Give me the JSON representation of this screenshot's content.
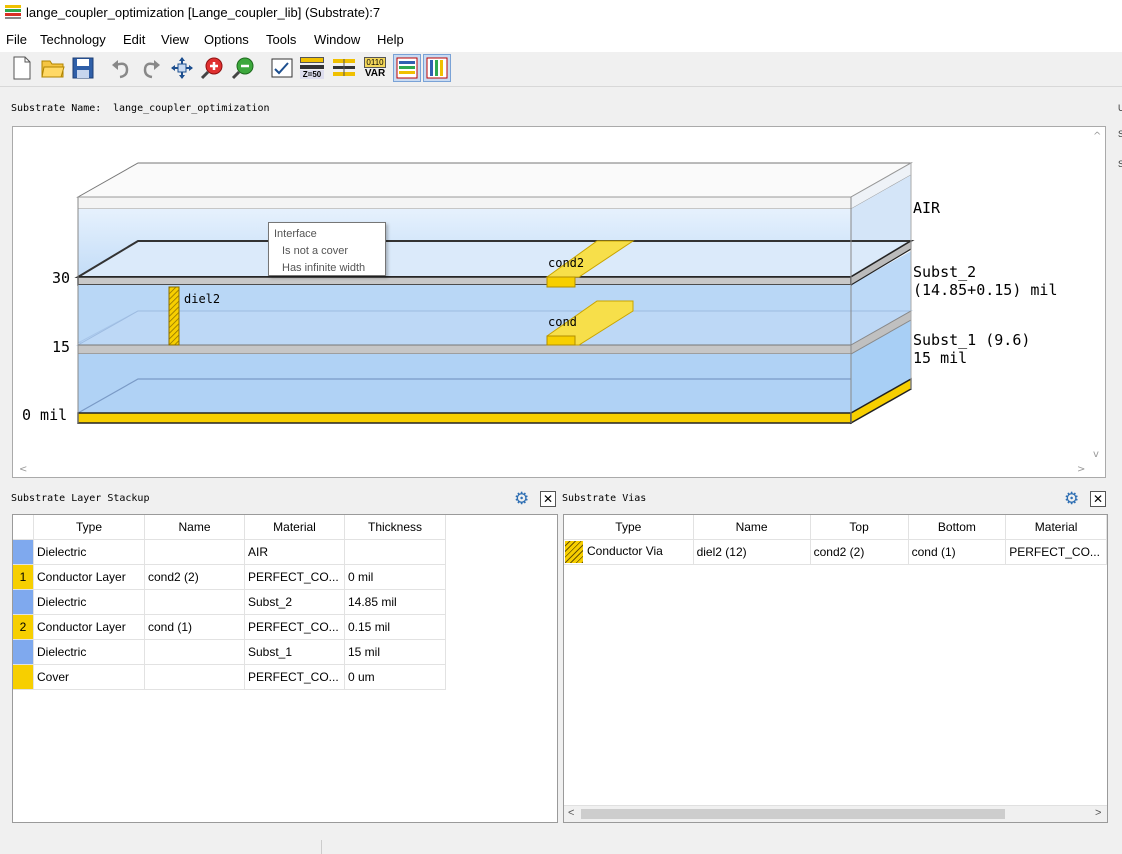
{
  "window": {
    "title": "lange_coupler_optimization [Lange_coupler_lib] (Substrate):7"
  },
  "menu": [
    "File",
    "Technology",
    "Edit",
    "View",
    "Options",
    "Tools",
    "Window",
    "Help"
  ],
  "toolbar": {
    "icons": [
      "new-file-icon",
      "open-folder-icon",
      "save-icon",
      "undo-icon",
      "redo-icon",
      "pan-icon",
      "zoom-in-icon",
      "zoom-out-icon",
      "check-icon",
      "z50-icon",
      "layer-align-icon",
      "var-icon",
      "horizontal-layers-icon",
      "vertical-layers-icon"
    ],
    "z50_label": "Z=50",
    "var_top": "0110",
    "var_label": "VAR"
  },
  "substrate": {
    "name_label": "Substrate Name:",
    "name_value": "lange_coupler_optimization"
  },
  "viewer": {
    "axis": {
      "t30": "30",
      "t15": "15",
      "t0": "0 mil"
    },
    "labels": {
      "air": "AIR",
      "subst2_a": "Subst_2",
      "subst2_b": "(14.85+0.15) mil",
      "subst1_a": "Subst_1 (9.6)",
      "subst1_b": "15 mil",
      "cond2": "cond2",
      "cond": "cond",
      "diel2": "diel2"
    },
    "tooltip": {
      "line1": "Interface",
      "line2": "Is not a cover",
      "line3": "Has infinite width"
    }
  },
  "stackup": {
    "title": "Substrate Layer Stackup",
    "columns": [
      "Type",
      "Name",
      "Material",
      "Thickness"
    ],
    "rows": [
      {
        "idx": "",
        "kind": "dielectric",
        "type": "Dielectric",
        "name": "",
        "material": "AIR",
        "thickness": ""
      },
      {
        "idx": "1",
        "kind": "conductor",
        "type": "Conductor Layer",
        "name": "cond2 (2)",
        "material": "PERFECT_CO...",
        "thickness": "0 mil"
      },
      {
        "idx": "",
        "kind": "dielectric",
        "type": "Dielectric",
        "name": "",
        "material": "Subst_2",
        "thickness": "14.85 mil"
      },
      {
        "idx": "2",
        "kind": "conductor",
        "type": "Conductor Layer",
        "name": "cond (1)",
        "material": "PERFECT_CO...",
        "thickness": "0.15 mil"
      },
      {
        "idx": "",
        "kind": "dielectric",
        "type": "Dielectric",
        "name": "",
        "material": "Subst_1",
        "thickness": "15 mil"
      },
      {
        "idx": "",
        "kind": "cover",
        "type": "Cover",
        "name": "",
        "material": "PERFECT_CO...",
        "thickness": "0 um"
      }
    ]
  },
  "vias": {
    "title": "Substrate Vias",
    "columns": [
      "Type",
      "Name",
      "Top",
      "Bottom",
      "Material"
    ],
    "rows": [
      {
        "type": "Conductor Via",
        "name": "diel2 (12)",
        "top": "cond2 (2)",
        "bottom": "cond (1)",
        "material": "PERFECT_CO..."
      }
    ]
  },
  "colors": {
    "dielectric": "#7fa9ee",
    "conductor": "#f7cf00",
    "selected_toolbar": "#c9dbf2"
  }
}
